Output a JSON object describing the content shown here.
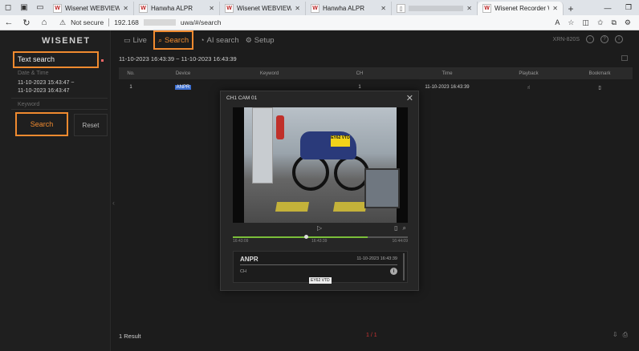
{
  "browser": {
    "tabs": [
      {
        "label": "Wisenet WEBVIEWER",
        "favicon": "W",
        "active": false
      },
      {
        "label": "Hanwha ALPR",
        "favicon": "W",
        "active": false
      },
      {
        "label": "Wisenet WEBVIEWER",
        "favicon": "W",
        "active": false
      },
      {
        "label": "Hanwha ALPR",
        "favicon": "W",
        "active": false
      },
      {
        "label": "",
        "favicon": "doc",
        "active": false
      },
      {
        "label": "Wisenet Recorder Webv",
        "favicon": "W",
        "active": true
      }
    ],
    "security_label": "Not secure",
    "url_prefix": "192.168",
    "url_suffix": "uwa/#/search"
  },
  "app": {
    "logo": "WISENET",
    "nav": [
      {
        "label": "Live",
        "icon": "monitor-icon"
      },
      {
        "label": "Search",
        "icon": "search-icon"
      },
      {
        "label": "AI search",
        "icon": "ai-search-icon"
      },
      {
        "label": "Setup",
        "icon": "gear-icon"
      }
    ],
    "model": "XRN-820S",
    "sidebar": {
      "title": "Text search",
      "date_label": "Date & Time",
      "date_from": "11-10-2023 15:43:47 ~",
      "date_to": "11-10-2023 16:43:47",
      "keyword_label": "Keyword",
      "search_button": "Search",
      "reset_button": "Reset"
    },
    "results": {
      "range": "11-10-2023 16:43:39 ~ 11-10-2023 16:43:39",
      "columns": [
        "No.",
        "Device",
        "Keyword",
        "CH",
        "Time",
        "Playback",
        "Bookmark"
      ],
      "rows": [
        {
          "no": "1",
          "device": "ANPR",
          "keyword": "",
          "ch": "1",
          "time": "11-10-2023 16:43:39"
        }
      ],
      "count": "1 Result",
      "pager": "1 / 1"
    },
    "modal": {
      "title": "CH1 CAM 01",
      "plate_in_video": "EY62 VTD",
      "time_start": "16:43:09",
      "time_mid": "16:43:39",
      "time_end": "16:44:09",
      "info_title": "ANPR",
      "info_time": "11-10-2023 16:43:39",
      "info_ch": "CH",
      "plate_tag": "EY62 VTD"
    }
  }
}
